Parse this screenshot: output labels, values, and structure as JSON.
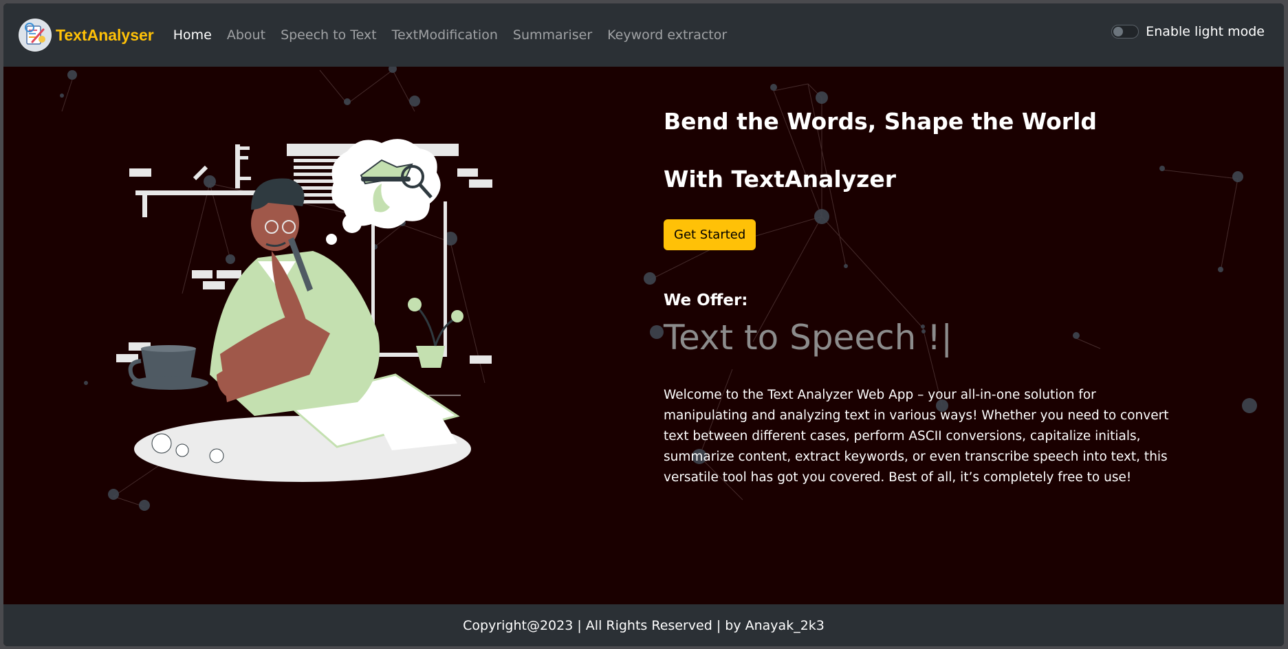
{
  "navbar": {
    "brand": "TextAnalyser",
    "links": [
      {
        "label": "Home",
        "active": true
      },
      {
        "label": "About",
        "active": false
      },
      {
        "label": "Speech to Text",
        "active": false
      },
      {
        "label": "TextModification",
        "active": false
      },
      {
        "label": "Summariser",
        "active": false
      },
      {
        "label": "Keyword extractor",
        "active": false
      }
    ],
    "toggle_label": "Enable light mode",
    "toggle_on": false
  },
  "hero": {
    "headline_1": "Bend the Words, Shape the World",
    "headline_2": "With TextAnalyzer",
    "cta_label": "Get Started",
    "offer_title": "We Offer:",
    "typed_text": "Text to Speech !|",
    "description": "Welcome to the Text Analyzer Web App – your all-in-one solution for manipulating and analyzing text in various ways! Whether you need to convert text between different cases, perform ASCII conversions, capitalize initials, summarize content, extract keywords, or even transcribe speech into text, this versatile tool has got you covered. Best of all, it’s completely free to use!"
  },
  "footer": {
    "text": "Copyright@2023 | All Rights Reserved | by Anayak_2k3"
  },
  "colors": {
    "background": "#1a0000",
    "navbar": "#2b3035",
    "accent": "#ffc107",
    "typed_text": "#8c8c8c",
    "illustration_green": "#c4e0b0",
    "skin": "#a0584a"
  },
  "icons": {
    "brand": "app-logo-icon",
    "toggle": "theme-toggle-switch"
  }
}
